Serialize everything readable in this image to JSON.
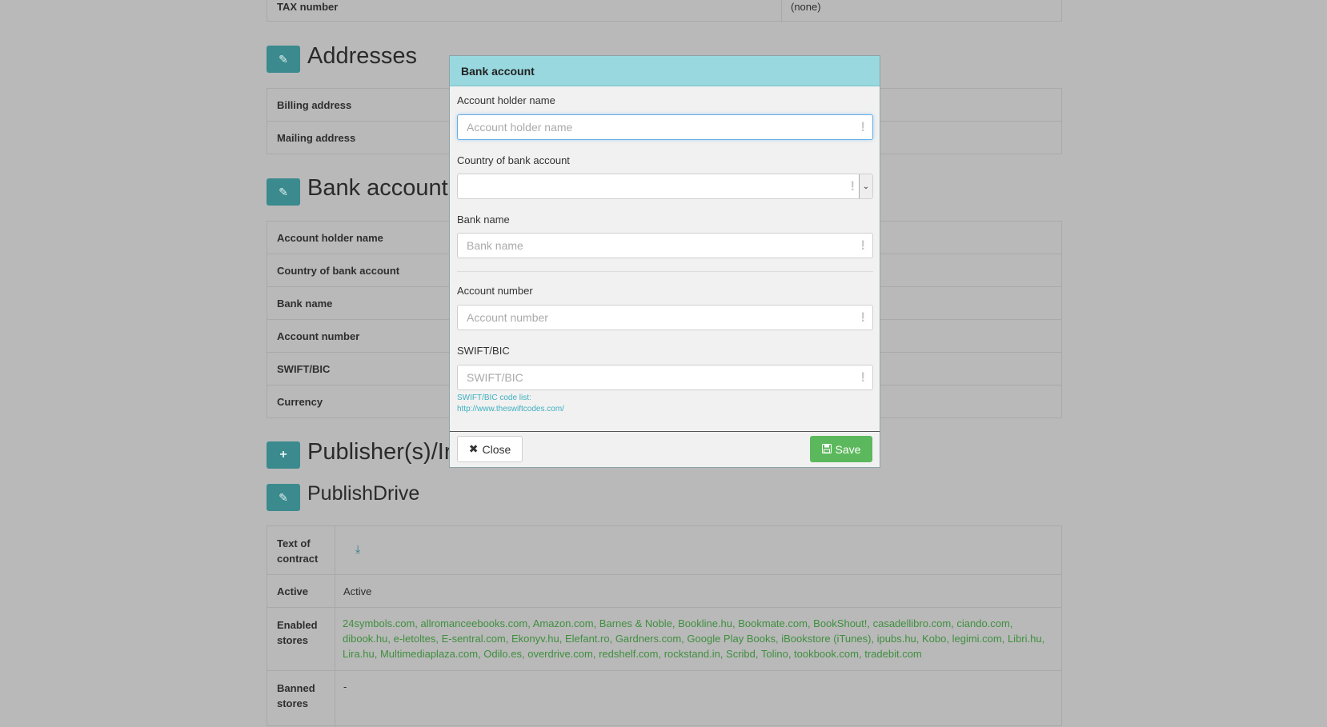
{
  "top_row": {
    "label": "TAX number",
    "value": "(none)"
  },
  "addresses": {
    "title": "Addresses",
    "rows": [
      {
        "label": "Billing address"
      },
      {
        "label": "Mailing address"
      }
    ]
  },
  "bank_section": {
    "title": "Bank account",
    "rows": [
      {
        "label": "Account holder name"
      },
      {
        "label": "Country of bank account"
      },
      {
        "label": "Bank name"
      },
      {
        "label": "Account number"
      },
      {
        "label": "SWIFT/BIC"
      },
      {
        "label": "Currency"
      }
    ]
  },
  "publishers": {
    "title": "Publisher(s)/Ir"
  },
  "publishdrive": {
    "title": "PublishDrive",
    "contract_label": "Text of contract",
    "active_label": "Active",
    "active_value": "Active",
    "enabled_label": "Enabled stores",
    "enabled_value": "24symbols.com, allromanceebooks.com, Amazon.com, Barnes & Noble, Bookline.hu, Bookmate.com, BookShout!, casadellibro.com, ciando.com, dibook.hu, e-letoltes, E-sentral.com, Ekonyv.hu, Elefant.ro, Gardners.com, Google Play Books, iBookstore (iTunes), ipubs.hu, Kobo, legimi.com, Libri.hu, Lira.hu, Multimediaplaza.com, Odilo.es, overdrive.com, redshelf.com, rockstand.in, Scribd, Tolino, tookbook.com, tradebit.com",
    "banned_label": "Banned stores",
    "banned_value": "-"
  },
  "modal": {
    "title": "Bank account",
    "fields": {
      "holder": {
        "label": "Account holder name",
        "placeholder": "Account holder name",
        "value": ""
      },
      "country": {
        "label": "Country of bank account",
        "value": ""
      },
      "bank": {
        "label": "Bank name",
        "placeholder": "Bank name",
        "value": ""
      },
      "account": {
        "label": "Account number",
        "placeholder": "Account number",
        "value": ""
      },
      "swift": {
        "label": "SWIFT/BIC",
        "placeholder": "SWIFT/BIC",
        "value": ""
      }
    },
    "help_line1": "SWIFT/BIC code list:",
    "help_line2": "http://www.theswiftcodes.com/",
    "close_label": "Close",
    "save_label": "Save",
    "required_mark": "!"
  },
  "icons": {
    "edit": "pencil-icon",
    "add": "plus-icon",
    "download": "download-icon",
    "close": "times-icon",
    "save": "floppy-disk-icon"
  },
  "colors": {
    "modal_header": "#98d8de",
    "save_button": "#5cb85c",
    "section_button": "#3a8a8e",
    "link": "#3fb0bf"
  }
}
